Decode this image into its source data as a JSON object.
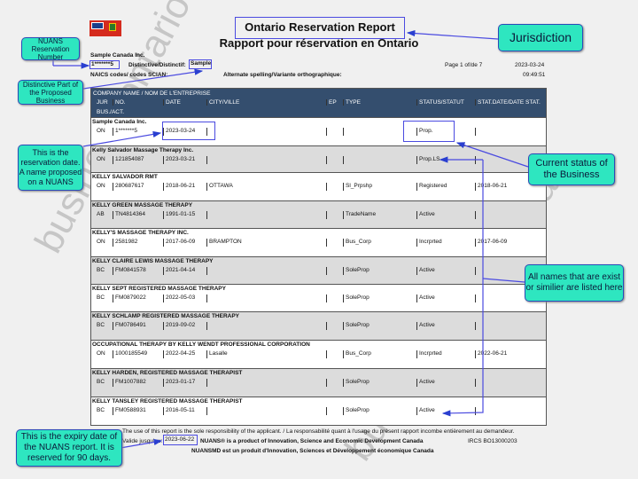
{
  "header": {
    "title_en": "Ontario Reservation Report",
    "title_fr": "Rapport pour réservation en Ontario",
    "applicant": "Sample Canada Inc.",
    "reservation_number": "1*******5",
    "distinctive_label": "Distinctive/Distinctif:",
    "distinctive_value": "Sample",
    "page": "Page 1 of/de 7",
    "date": "2023-03-24",
    "time": "09:49:51",
    "naics_label": "NAICS codes/ codes SCIAN:",
    "alt_label": "Alternate spelling/Variante orthographique:"
  },
  "table": {
    "company_header": "COMPANY NAME / NOM DE L'ENTREPRISE",
    "columns": [
      "JUR",
      "NO.",
      "DATE",
      "CITY/VILLE",
      "EP",
      "TYPE",
      "STATUS/STATUT",
      "STAT.DATE/DATE STAT."
    ],
    "bus_act": "BUS./ACT.",
    "rows": [
      {
        "name": "Sample Canada Inc.",
        "jur": "ON",
        "no": "1*******5",
        "date": "2023-03-24",
        "city": "",
        "ep": "",
        "type": "",
        "status": "Prop.",
        "stat_date": ""
      },
      {
        "name": "Kelly Salvador Massage Therapy Inc.",
        "jur": "ON",
        "no": "121854087",
        "date": "2023-03-21",
        "city": "",
        "ep": "",
        "type": "",
        "status": "Prop.LS",
        "stat_date": ""
      },
      {
        "name": "KELLY SALVADOR RMT",
        "jur": "ON",
        "no": "280687617",
        "date": "2018-06-21",
        "city": "OTTAWA",
        "ep": "",
        "type": "Sl_Prpshp",
        "status": "Registered",
        "stat_date": "2018-06-21"
      },
      {
        "name": "KELLY GREEN MASSAGE THERAPY",
        "jur": "AB",
        "no": "TN4814364",
        "date": "1991-01-15",
        "city": "",
        "ep": "",
        "type": "TradeName",
        "status": "Active",
        "stat_date": ""
      },
      {
        "name": "KELLY'S MASSAGE THERAPY INC.",
        "jur": "ON",
        "no": "2581982",
        "date": "2017-06-09",
        "city": "BRAMPTON",
        "ep": "",
        "type": "Bus_Corp",
        "status": "Incrprted",
        "stat_date": "2017-06-09"
      },
      {
        "name": "KELLY CLAIRE LEWIS MASSAGE THERAPY",
        "jur": "BC",
        "no": "FM0841578",
        "date": "2021-04-14",
        "city": "",
        "ep": "",
        "type": "SoleProp",
        "status": "Active",
        "stat_date": ""
      },
      {
        "name": "KELLY SEPT REGISTERED MASSAGE THERAPY",
        "jur": "BC",
        "no": "FM0879022",
        "date": "2022-05-03",
        "city": "",
        "ep": "",
        "type": "SoleProp",
        "status": "Active",
        "stat_date": ""
      },
      {
        "name": "KELLY SCHLAMP REGISTERED MASSAGE THERAPY",
        "jur": "BC",
        "no": "FM0786491",
        "date": "2019-09-02",
        "city": "",
        "ep": "",
        "type": "SoleProp",
        "status": "Active",
        "stat_date": ""
      },
      {
        "name": "OCCUPATIONAL THERAPY BY KELLY WENDT PROFESSIONAL CORPORATION",
        "jur": "ON",
        "no": "1000185549",
        "date": "2022-04-25",
        "city": "Lasalle",
        "ep": "",
        "type": "Bus_Corp",
        "status": "Incrprted",
        "stat_date": "2022-06-21"
      },
      {
        "name": "KELLY HARDEN, REGISTERED MASSAGE THERAPIST",
        "jur": "BC",
        "no": "FM1007882",
        "date": "2023-01-17",
        "city": "",
        "ep": "",
        "type": "SoleProp",
        "status": "Active",
        "stat_date": ""
      },
      {
        "name": "KELLY TANSLEY REGISTERED MASSAGE THERAPIST",
        "jur": "BC",
        "no": "FM0588931",
        "date": "2016-05-11",
        "city": "",
        "ep": "",
        "type": "SoleProp",
        "status": "Active",
        "stat_date": ""
      }
    ]
  },
  "footer": {
    "disclaimer": "The use of this report is the sole responsibility of the applicant. / La responsabilité quant à l'usage du présent rapport incombe entièrement au demandeur.",
    "valid_label": "Valide jusqu'au:",
    "valid_date": "2023-06-22",
    "nuans_en": "NUANS® is a product of Innovation, Science and Economic Development Canada",
    "ircs": "IRCS BO13000203",
    "nuans_fr": "NUANSMD est un produit d'Innovation, Sciences et Développement économique Canada"
  },
  "callouts": {
    "jurisdiction": "Jurisdiction",
    "number": "NUANS Reservation Number",
    "distinctive": "Distinctive Part of the Proposed Business",
    "res_date": "This is the reservation date. A name proposed on a NUANS",
    "status": "Current status of the Business",
    "names": "All names that are exist or similier are listed here",
    "expiry": "This is the expiry date of the NUANS report. It is reserved for 90 days."
  },
  "watermark": "business-ontario.ca",
  "colors": {
    "header_bg": "#344e6e",
    "callout_bg": "#2ee6c0",
    "highlight": "#4a4ae0"
  }
}
